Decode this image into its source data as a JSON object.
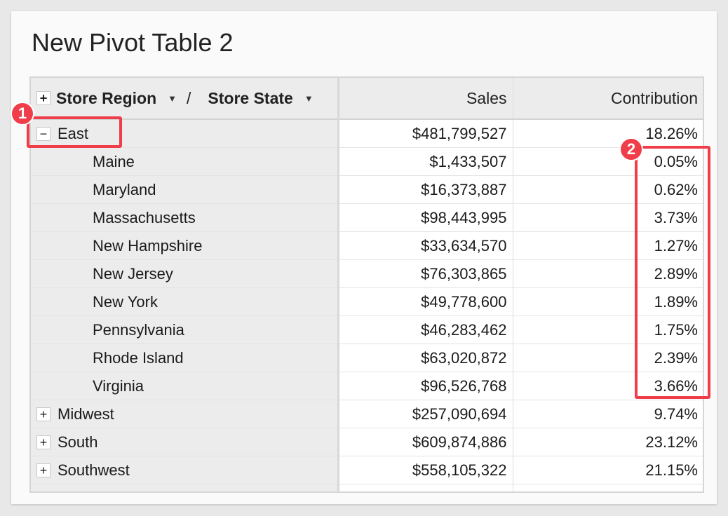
{
  "title": "New Pivot Table 2",
  "header": {
    "expand_glyph": "+",
    "row_field_1": "Store Region",
    "separator": "/",
    "row_field_2": "Store State",
    "dropdown_glyph": "▼",
    "col_sales": "Sales",
    "col_contribution": "Contribution"
  },
  "rows": {
    "east": {
      "glyph": "−",
      "name": "East",
      "sales": "$481,799,527",
      "contribution": "18.26%"
    },
    "states": [
      {
        "name": "Maine",
        "sales": "$1,433,507",
        "contribution": "0.05%"
      },
      {
        "name": "Maryland",
        "sales": "$16,373,887",
        "contribution": "0.62%"
      },
      {
        "name": "Massachusetts",
        "sales": "$98,443,995",
        "contribution": "3.73%"
      },
      {
        "name": "New Hampshire",
        "sales": "$33,634,570",
        "contribution": "1.27%"
      },
      {
        "name": "New Jersey",
        "sales": "$76,303,865",
        "contribution": "2.89%"
      },
      {
        "name": "New York",
        "sales": "$49,778,600",
        "contribution": "1.89%"
      },
      {
        "name": "Pennsylvania",
        "sales": "$46,283,462",
        "contribution": "1.75%"
      },
      {
        "name": "Rhode Island",
        "sales": "$63,020,872",
        "contribution": "2.39%"
      },
      {
        "name": "Virginia",
        "sales": "$96,526,768",
        "contribution": "3.66%"
      }
    ],
    "regions": [
      {
        "glyph": "+",
        "name": "Midwest",
        "sales": "$257,090,694",
        "contribution": "9.74%"
      },
      {
        "glyph": "+",
        "name": "South",
        "sales": "$609,874,886",
        "contribution": "23.12%"
      },
      {
        "glyph": "+",
        "name": "Southwest",
        "sales": "$558,105,322",
        "contribution": "21.15%"
      }
    ]
  },
  "annotations": {
    "marker_1": "1",
    "marker_2": "2"
  },
  "colors": {
    "annotation": "#ef3e4a",
    "row_header_bg": "#ececec"
  }
}
